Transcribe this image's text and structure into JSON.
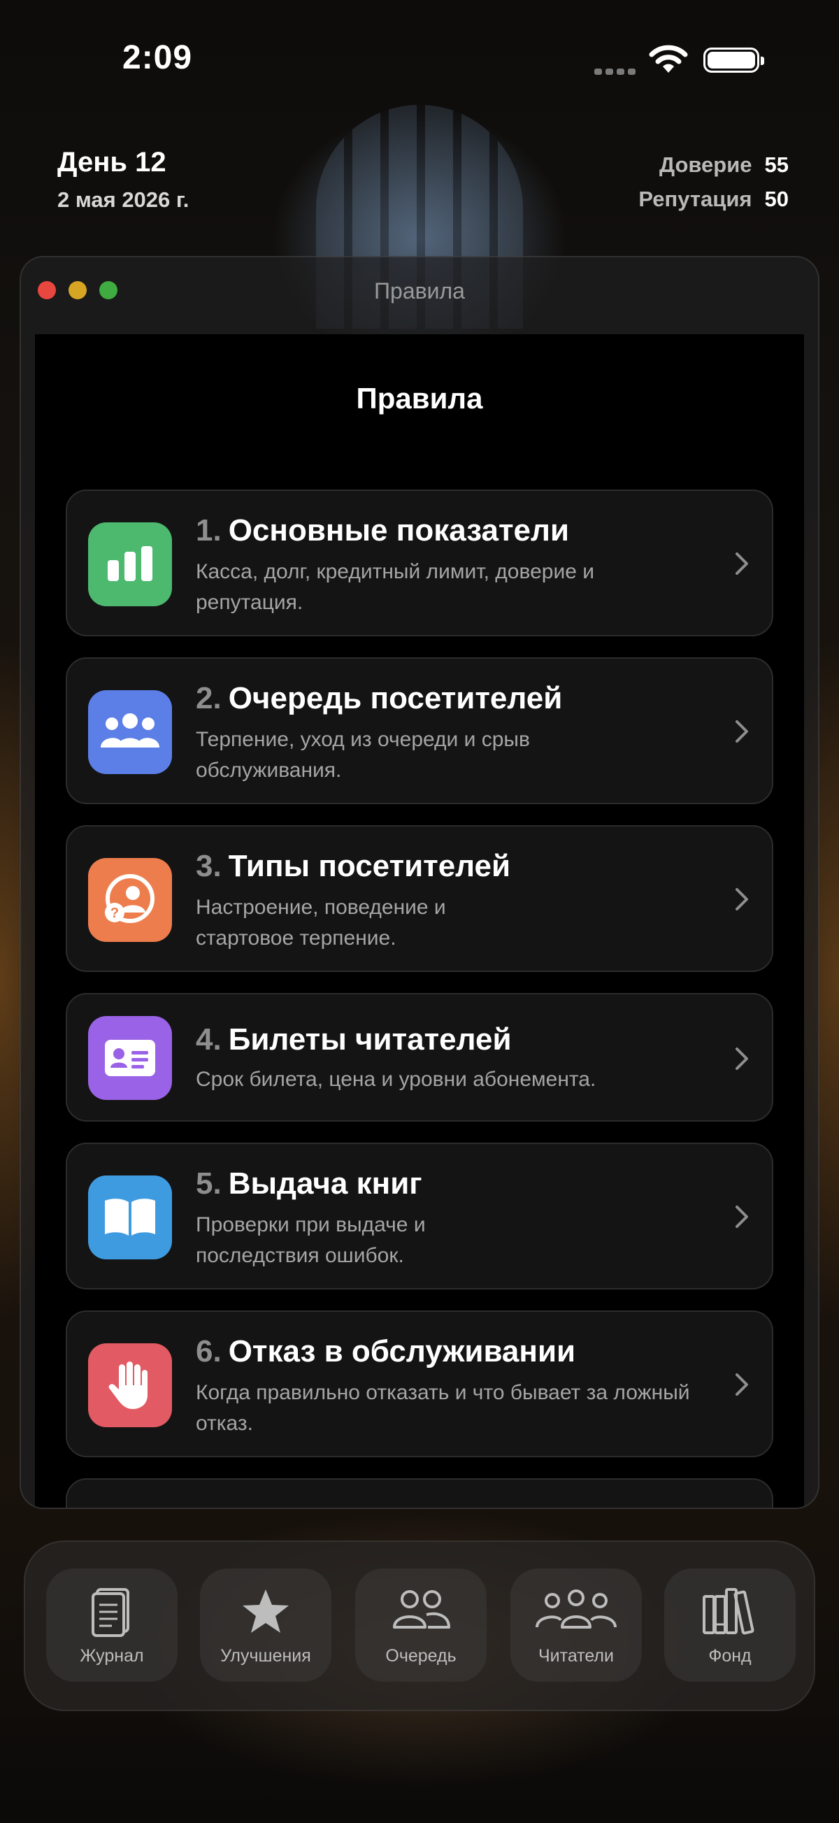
{
  "status_bar": {
    "time": "2:09"
  },
  "header": {
    "day": "День 12",
    "date": "2 мая 2026 г.",
    "trust_label": "Доверие",
    "trust_value": "55",
    "reputation_label": "Репутация",
    "reputation_value": "50"
  },
  "window": {
    "title": "Правила",
    "heading": "Правила"
  },
  "rules": [
    {
      "num": "1.",
      "title": "Основные показатели",
      "desc": "Касса, долг, кредитный лимит, доверие и репутация.",
      "icon": "chart-bars-icon",
      "color": "#4cb96f"
    },
    {
      "num": "2.",
      "title": "Очередь посетителей",
      "desc": "Терпение, уход из очереди и срыв обслуживания.",
      "icon": "people-group-icon",
      "color": "#5b7fe6"
    },
    {
      "num": "3.",
      "title": "Типы посетителей",
      "desc": "Настроение, поведение и стартовое терпение.",
      "icon": "person-question-icon",
      "color": "#ee7d4d"
    },
    {
      "num": "4.",
      "title": "Билеты читателей",
      "desc": "Срок билета, цена и уровни абонемента.",
      "icon": "id-card-icon",
      "color": "#9a62e6"
    },
    {
      "num": "5.",
      "title": "Выдача книг",
      "desc": "Проверки при выдаче и последствия ошибок.",
      "icon": "open-book-icon",
      "color": "#3f9be0"
    },
    {
      "num": "6.",
      "title": "Отказ в обслуживании",
      "desc": "Когда правильно отказать и что бывает за ложный отказ.",
      "icon": "hand-stop-icon",
      "color": "#e25a63"
    }
  ],
  "tabs": [
    {
      "label": "Журнал",
      "icon": "journal-icon"
    },
    {
      "label": "Улучшения",
      "icon": "star-icon"
    },
    {
      "label": "Очередь",
      "icon": "queue-people-icon"
    },
    {
      "label": "Читатели",
      "icon": "readers-icon"
    },
    {
      "label": "Фонд",
      "icon": "books-shelf-icon"
    }
  ]
}
